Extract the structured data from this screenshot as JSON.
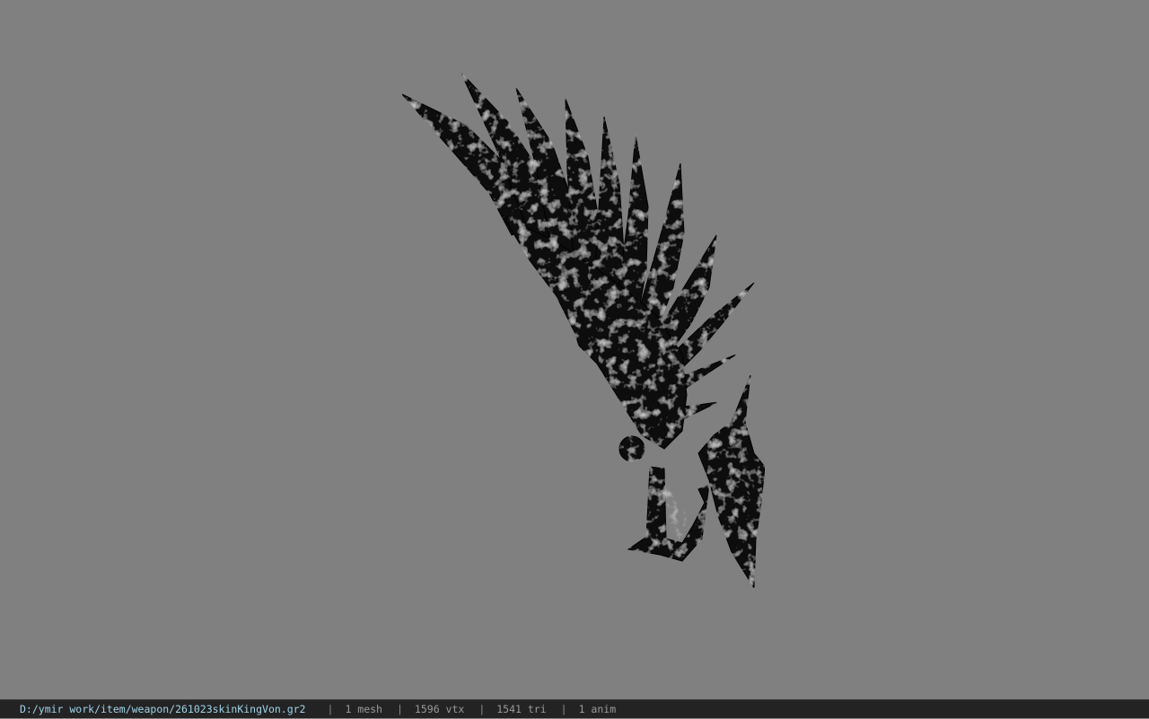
{
  "viewer": {
    "background_color": "#808080",
    "model_color": "#0a0a0a",
    "model_highlight_color": "#9a9a9a"
  },
  "statusbar": {
    "file_path": "D:/ymir work/item/weapon/261023skinKingVon.gr2",
    "separator": "|",
    "mesh_count": "1 mesh",
    "vertex_count": "1596 vtx",
    "triangle_count": "1541 tri",
    "anim_count": "1 anim"
  }
}
